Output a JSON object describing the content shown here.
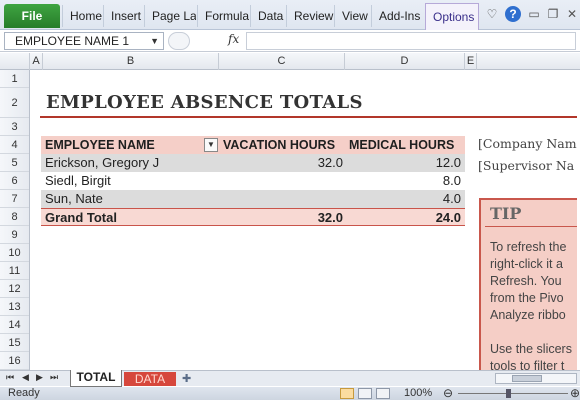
{
  "ribbon": {
    "file_label": "File",
    "tabs": [
      "Home",
      "Insert",
      "Page Lay",
      "Formula",
      "Data",
      "Review",
      "View",
      "Add-Ins",
      "Options"
    ],
    "icons": [
      "heart-icon",
      "help-icon",
      "minimize-icon",
      "restore-icon",
      "close-icon"
    ]
  },
  "formula_bar": {
    "name_box": "EMPLOYEE NAME 1",
    "fx": "fx",
    "value": ""
  },
  "columns": [
    "A",
    "B",
    "C",
    "D",
    "E"
  ],
  "rows": [
    "1",
    "2",
    "3",
    "4",
    "5",
    "6",
    "7",
    "8",
    "9",
    "10",
    "11",
    "12",
    "13",
    "14",
    "15",
    "16"
  ],
  "sheet": {
    "title": "EMPLOYEE ABSENCE TOTALS",
    "pivot": {
      "headers": {
        "name": "EMPLOYEE NAME",
        "vacation": "VACATION HOURS",
        "medical": "MEDICAL HOURS"
      },
      "rows": [
        {
          "name": "Erickson, Gregory J",
          "vacation": "32.0",
          "medical": "12.0"
        },
        {
          "name": "Siedl, Birgit",
          "vacation": "",
          "medical": "8.0"
        },
        {
          "name": "Sun, Nate",
          "vacation": "",
          "medical": "4.0"
        }
      ],
      "total": {
        "name": "Grand Total",
        "vacation": "32.0",
        "medical": "24.0"
      }
    },
    "company_name": "[Company Nam",
    "supervisor_name": "[Supervisor Na",
    "tip": {
      "title": "TIP",
      "lines": [
        "To refresh  the",
        "right-click it a",
        "Refresh.  You",
        "from the Pivo",
        "Analyze ribbo",
        "",
        "Use the slicers",
        "tools to filter t"
      ]
    }
  },
  "sheet_tabs": {
    "active": "TOTAL",
    "other": "DATA"
  },
  "status": {
    "ready": "Ready",
    "zoom": "100%"
  },
  "colors": {
    "accent": "#b2362a",
    "pivot_header": "#f5cfc8",
    "file_tab": "#2e8b32",
    "data_tab": "#d6473c"
  }
}
